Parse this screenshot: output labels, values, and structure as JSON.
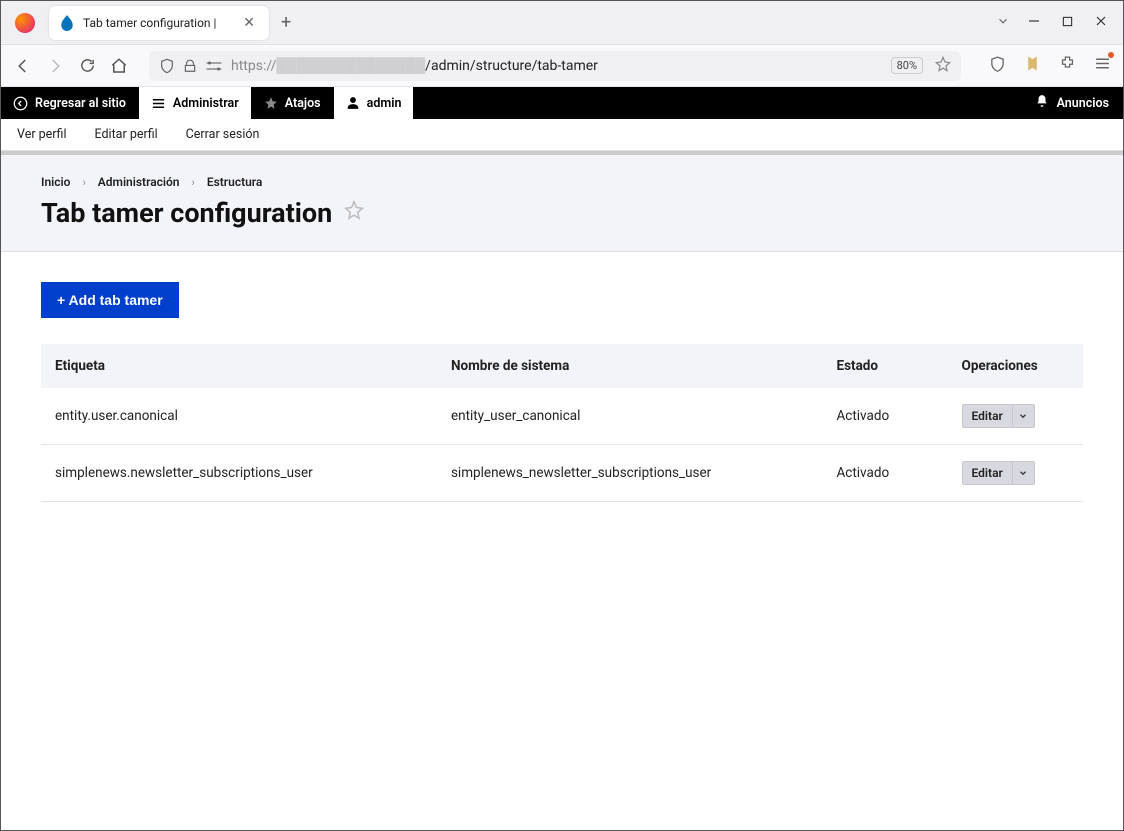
{
  "browser": {
    "tab_title": "Tab tamer configuration |",
    "url_prefix": "https://",
    "url_path": "/admin/structure/tab-tamer",
    "zoom": "80%"
  },
  "admin_toolbar": {
    "back_to_site": "Regresar al sitio",
    "manage": "Administrar",
    "shortcuts": "Atajos",
    "user": "admin",
    "announcements": "Anuncios"
  },
  "sub_toolbar": {
    "view_profile": "Ver perfil",
    "edit_profile": "Editar perfil",
    "logout": "Cerrar sesión"
  },
  "breadcrumb": {
    "home": "Inicio",
    "admin": "Administración",
    "structure": "Estructura"
  },
  "page": {
    "title": "Tab tamer configuration",
    "add_button": "+ Add tab tamer"
  },
  "table": {
    "headers": {
      "label": "Etiqueta",
      "system_name": "Nombre de sistema",
      "state": "Estado",
      "operations": "Operaciones"
    },
    "rows": [
      {
        "label": "entity.user.canonical",
        "system_name": "entity_user_canonical",
        "state": "Activado",
        "op": "Editar"
      },
      {
        "label": "simplenews.newsletter_subscriptions_user",
        "system_name": "simplenews_newsletter_subscriptions_user",
        "state": "Activado",
        "op": "Editar"
      }
    ]
  }
}
